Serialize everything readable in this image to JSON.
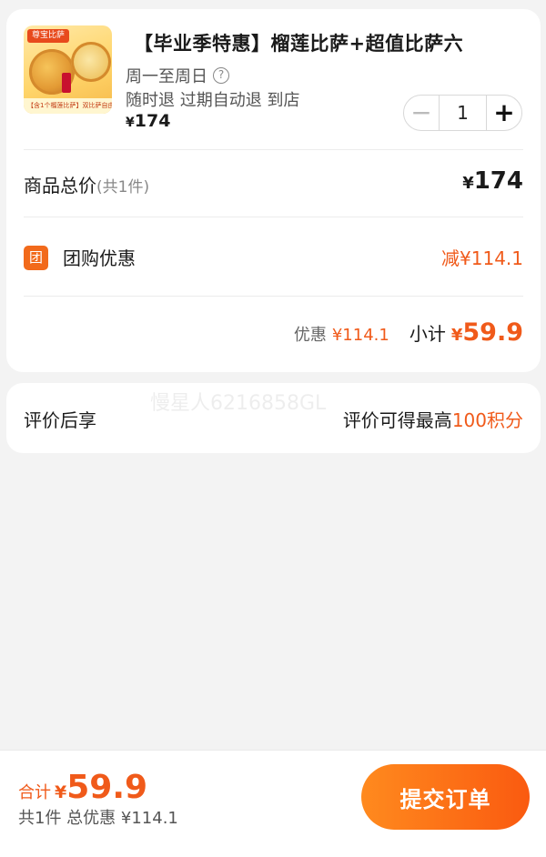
{
  "product": {
    "title": "【毕业季特惠】榴莲比萨+超值比萨六",
    "image_brand": "尊宝比萨",
    "image_banner": "【含1个榴莲比萨】双比萨自由任选",
    "availability": "周一至周日",
    "help_icon": "?",
    "refund_policy": "随时退 过期自动退 到店",
    "currency": "¥",
    "price": "174",
    "quantity": "1",
    "minus_icon": "−",
    "plus_icon": "+"
  },
  "summary": {
    "total_label": "商品总价",
    "total_count": "(共1件)",
    "total_value": "174",
    "group_icon_char": "团",
    "group_discount_label": "团购优惠",
    "group_discount_value": "减¥114.1",
    "discount_label": "优惠",
    "discount_value": "¥114.1",
    "subtotal_label": "小计",
    "subtotal_value": "59.9"
  },
  "review": {
    "label": "评价后享",
    "reward_prefix": "评价可得最高",
    "reward_value": "100积分"
  },
  "watermark": "慢星人6216858GL",
  "bottom_bar": {
    "total_label": "合计",
    "currency": "¥",
    "total_value": "59.9",
    "summary": "共1件 总优惠 ¥114.1",
    "submit_label": "提交订单"
  },
  "colors": {
    "accent": "#f05a1a",
    "button_start": "#ff8a1e",
    "button_end": "#fa5a10",
    "background": "#f3f3f3"
  },
  "icons": [
    "help-circle-icon",
    "minus-icon",
    "plus-icon",
    "group-buy-icon"
  ]
}
